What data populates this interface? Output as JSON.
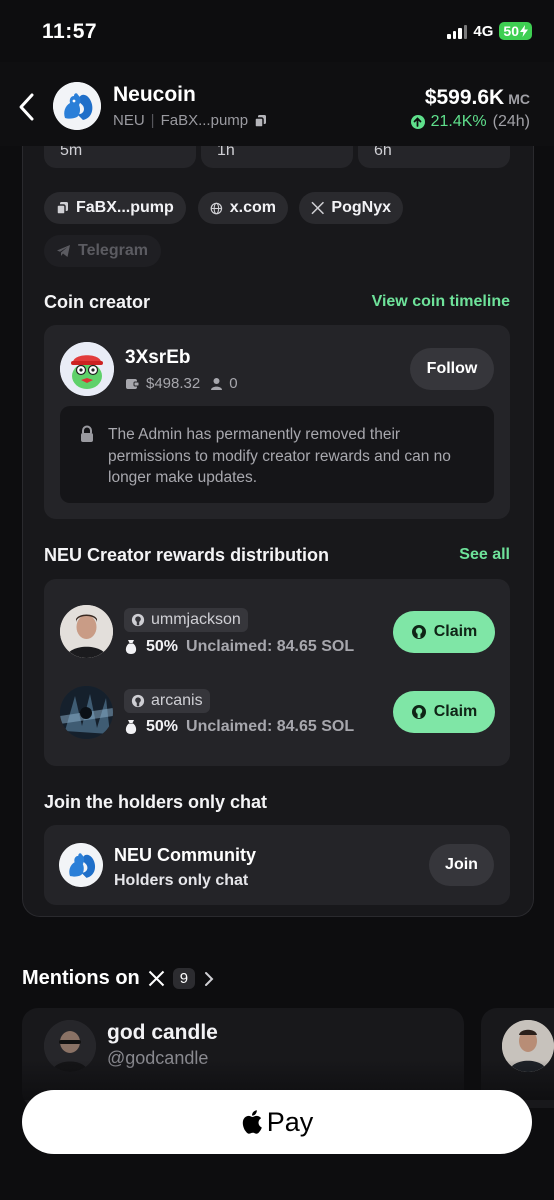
{
  "status_bar": {
    "time": "11:57",
    "network": "4G",
    "battery": "50"
  },
  "header": {
    "coin_name": "Neucoin",
    "ticker": "NEU",
    "contract": "FaBX...pump",
    "market_cap": "$599.6K",
    "mc_label": "MC",
    "change": "21.4K%",
    "period": "(24h)"
  },
  "timeframes": [
    "5m",
    "1h",
    "6h"
  ],
  "links": {
    "contract_chip": "FaBX...pump",
    "website_chip": "x.com",
    "x_chip": "PogNyx",
    "telegram_chip": "Telegram"
  },
  "creator": {
    "section_title": "Coin creator",
    "timeline_link": "View coin timeline",
    "username": "3XsrEb",
    "balance": "$498.32",
    "followers": "0",
    "follow_label": "Follow",
    "notice": "The Admin has permanently removed their permissions to modify creator rewards and can no longer make updates."
  },
  "rewards": {
    "section_title": "NEU Creator rewards distribution",
    "see_all": "See all",
    "items": [
      {
        "github": "ummjackson",
        "share": "50%",
        "unclaimed": "Unclaimed: 84.65 SOL",
        "claim_label": "Claim"
      },
      {
        "github": "arcanis",
        "share": "50%",
        "unclaimed": "Unclaimed: 84.65 SOL",
        "claim_label": "Claim"
      }
    ]
  },
  "community": {
    "section_title": "Join the holders only chat",
    "name": "NEU Community",
    "subtitle": "Holders only chat",
    "join_label": "Join"
  },
  "mentions": {
    "title": "Mentions on",
    "count": "9",
    "first": {
      "name": "god candle",
      "handle": "@godcandle"
    }
  },
  "pay": {
    "label": "Pay"
  },
  "colors": {
    "accent_green": "#6ee29a",
    "claim_green": "#7fe6a6",
    "background": "#0d0d0f"
  }
}
